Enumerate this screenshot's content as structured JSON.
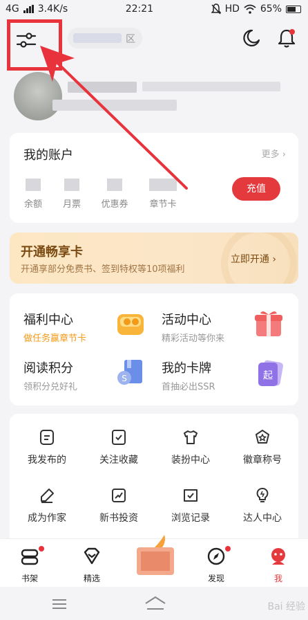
{
  "status": {
    "network": "4G",
    "speed": "3.4K/s",
    "time": "22:21",
    "hd": "HD",
    "battery": "65%"
  },
  "header": {
    "search_suffix": "区"
  },
  "account": {
    "title": "我的账户",
    "more": "更多",
    "items": [
      "余额",
      "月票",
      "优惠券",
      "章节卡"
    ],
    "recharge": "充值"
  },
  "vip": {
    "title": "开通畅享卡",
    "subtitle": "开通享部分免费书、签到特权等10项福利",
    "cta": "立即开通"
  },
  "grid": [
    {
      "title": "福利中心",
      "sub": "做任务赢章节卡"
    },
    {
      "title": "活动中心",
      "sub": "精彩活动等你来"
    },
    {
      "title": "阅读积分",
      "sub": "领积分兑好礼"
    },
    {
      "title": "我的卡牌",
      "sub": "首抽必出SSR"
    }
  ],
  "functions": [
    "我发布的",
    "关注收藏",
    "装扮中心",
    "徽章称号",
    "成为作家",
    "新书投资",
    "浏览记录",
    "达人中心"
  ],
  "tabs": [
    "书架",
    "精选",
    "发现",
    "我"
  ],
  "accent": "#e43a3e",
  "watermark": "Bai 经验"
}
